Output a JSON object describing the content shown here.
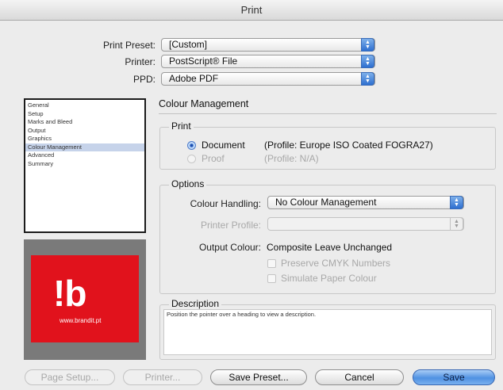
{
  "window": {
    "title": "Print"
  },
  "header": {
    "preset_label": "Print Preset:",
    "preset_value": "[Custom]",
    "printer_label": "Printer:",
    "printer_value": "PostScript® File",
    "ppd_label": "PPD:",
    "ppd_value": "Adobe PDF"
  },
  "sidebar": {
    "items": [
      {
        "label": "General"
      },
      {
        "label": "Setup"
      },
      {
        "label": "Marks and Bleed"
      },
      {
        "label": "Output"
      },
      {
        "label": "Graphics"
      },
      {
        "label": "Colour Management"
      },
      {
        "label": "Advanced"
      },
      {
        "label": "Summary"
      }
    ],
    "selected_index": 5
  },
  "preview": {
    "logo_mark": "!b",
    "logo_url": "www.brandit.pt",
    "logo_color": "#e1121c"
  },
  "colour_management": {
    "title": "Colour Management",
    "print_group": {
      "label": "Print",
      "document_label": "Document",
      "document_profile": "(Profile: Europe ISO Coated FOGRA27)",
      "proof_label": "Proof",
      "proof_profile": "(Profile: N/A)"
    },
    "options_group": {
      "label": "Options",
      "colour_handling_label": "Colour Handling:",
      "colour_handling_value": "No Colour Management",
      "printer_profile_label": "Printer Profile:",
      "printer_profile_value": "",
      "output_colour_label": "Output Colour:",
      "output_colour_value": "Composite Leave Unchanged",
      "preserve_cmyk_label": "Preserve CMYK Numbers",
      "simulate_paper_label": "Simulate Paper Colour"
    },
    "description": {
      "label": "Description",
      "text": "Position the pointer over a heading to view a description."
    }
  },
  "buttons": {
    "page_setup": "Page Setup...",
    "printer": "Printer...",
    "save_preset": "Save Preset...",
    "cancel": "Cancel",
    "save": "Save"
  },
  "colors": {
    "accent": "#4f91e2",
    "selection": "#c6d3ea"
  }
}
